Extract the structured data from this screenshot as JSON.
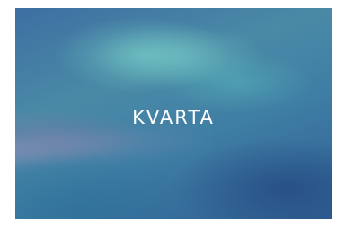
{
  "splash": {
    "brand": "KVARTA"
  }
}
